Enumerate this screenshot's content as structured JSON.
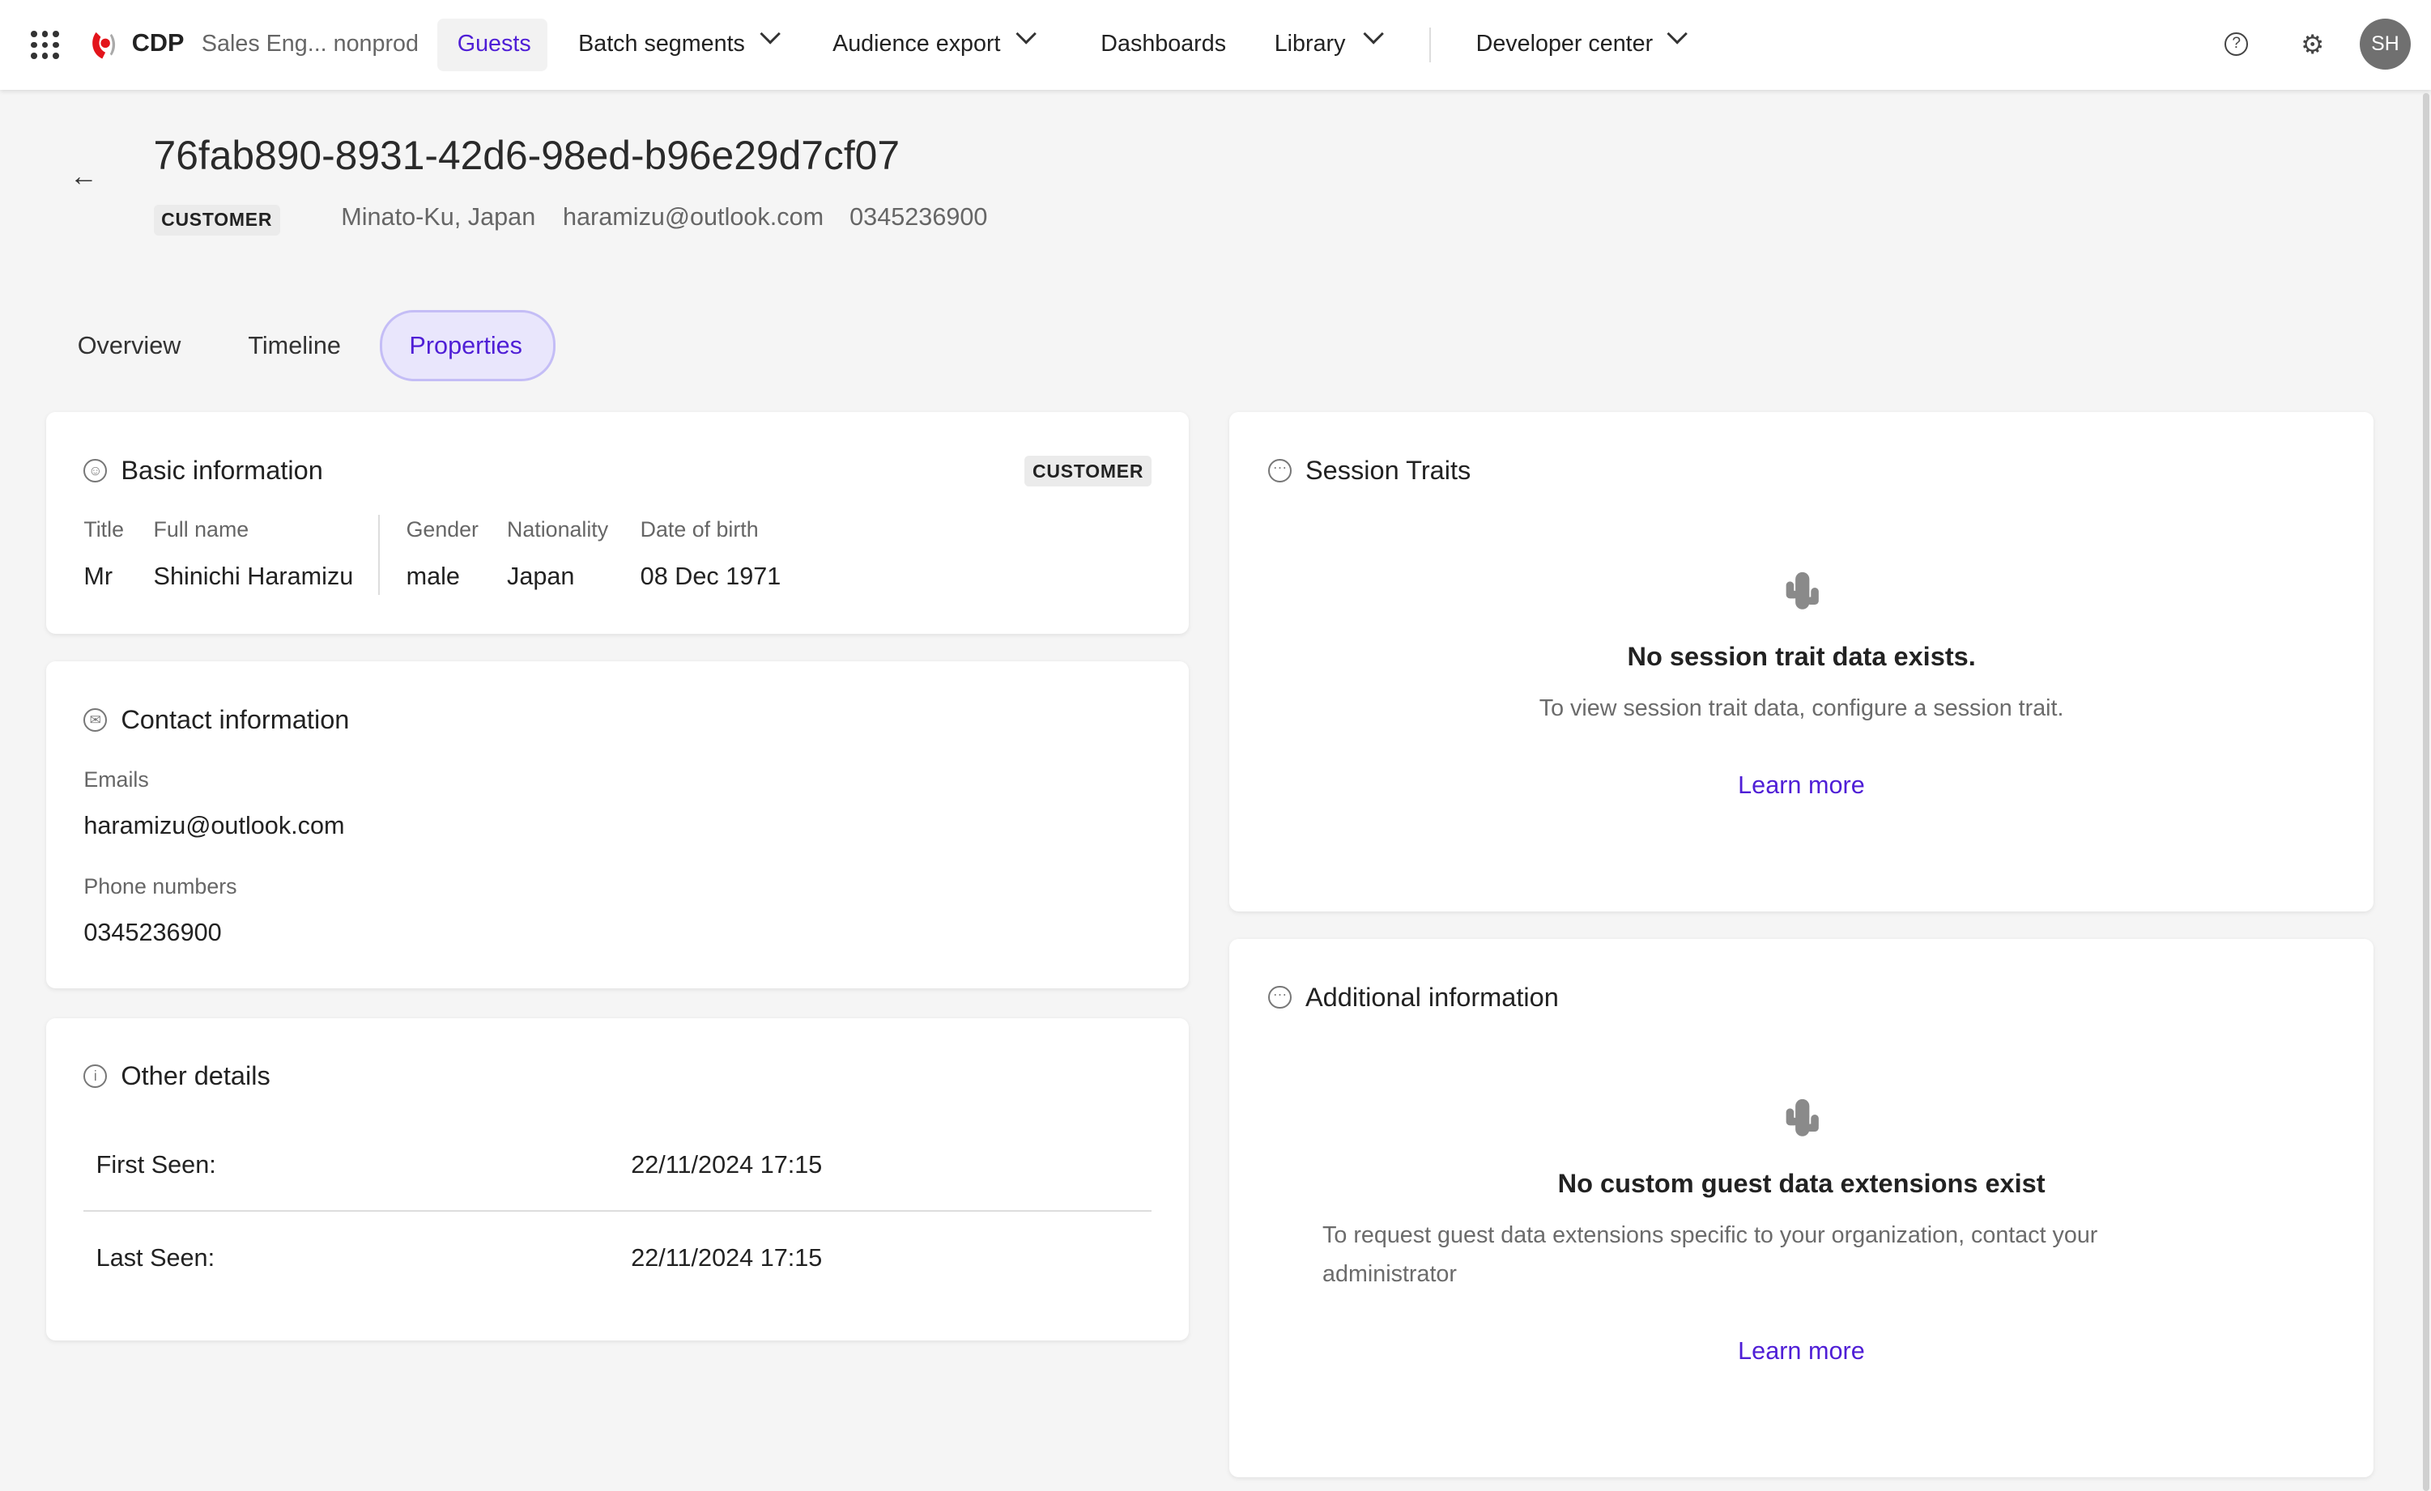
{
  "topbar": {
    "brand": "CDP",
    "org": "Sales Eng... nonprod",
    "nav": [
      {
        "label": "Guests",
        "active": true
      },
      {
        "label": "Batch segments"
      },
      {
        "label": "Audience export"
      },
      {
        "label": "Dashboards"
      },
      {
        "label": "Library"
      },
      {
        "label": "Developer center"
      }
    ],
    "avatar": "SH",
    "icons": [
      "apps-grid-icon",
      "help-icon",
      "settings-icon"
    ]
  },
  "header": {
    "id": "76fab890-8931-42d6-98ed-b96e29d7cf07",
    "badge": "CUSTOMER",
    "location": "Minato-Ku, Japan",
    "email": "haramizu@outlook.com",
    "phone": "0345236900"
  },
  "tabs": [
    "Overview",
    "Timeline",
    "Properties"
  ],
  "basic": {
    "title": "Basic information",
    "badge": "CUSTOMER",
    "fields": [
      {
        "label": "Title",
        "value": "Mr"
      },
      {
        "label": "Full name",
        "value": "Shinichi Haramizu"
      },
      {
        "label": "Gender",
        "value": "male"
      },
      {
        "label": "Nationality",
        "value": "Japan"
      },
      {
        "label": "Date of birth",
        "value": "08 Dec 1971"
      }
    ]
  },
  "contact": {
    "title": "Contact information",
    "emails_label": "Emails",
    "email": "haramizu@outlook.com",
    "phones_label": "Phone numbers",
    "phone": "0345236900"
  },
  "other": {
    "title": "Other details",
    "rows": [
      {
        "label": "First Seen:",
        "value": "22/11/2024 17:15"
      },
      {
        "label": "Last Seen:",
        "value": "22/11/2024 17:15"
      }
    ]
  },
  "session": {
    "title": "Session Traits",
    "empty_title": "No session trait data exists.",
    "empty_sub": "To view session trait data, configure a session trait.",
    "link": "Learn more"
  },
  "additional": {
    "title": "Additional information",
    "empty_title": "No custom guest data extensions exist",
    "empty_sub": "To request guest data extensions specific to your organization, contact your administrator",
    "link": "Learn more"
  },
  "colors": {
    "accent": "#4f1ed6",
    "brand": "#e3141b"
  }
}
